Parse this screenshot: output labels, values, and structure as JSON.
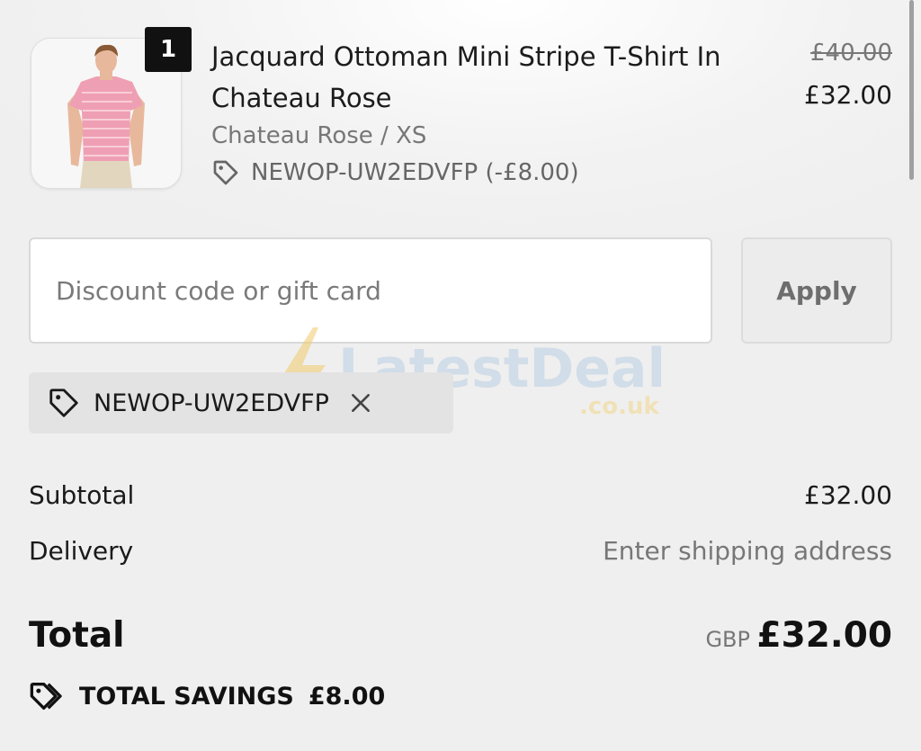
{
  "product": {
    "quantity": "1",
    "title": "Jacquard Ottoman Mini Stripe T-Shirt In Chateau Rose",
    "variant": "Chateau Rose / XS",
    "applied_code": "NEWOP-UW2EDVFP (-£8.00)",
    "original_price": "£40.00",
    "price": "£32.00",
    "image_icon": "product-photo"
  },
  "discount": {
    "placeholder": "Discount code or gift card",
    "value": "",
    "apply_label": "Apply",
    "chip_code": "NEWOP-UW2EDVFP"
  },
  "watermark": {
    "brand": "LatestDeals",
    "domain": ".co.uk"
  },
  "summary": {
    "subtotal_label": "Subtotal",
    "subtotal_value": "£32.00",
    "delivery_label": "Delivery",
    "delivery_value": "Enter shipping address",
    "total_label": "Total",
    "currency": "GBP",
    "total_value": "£32.00",
    "savings_label": "TOTAL SAVINGS",
    "savings_value": "£8.00"
  },
  "colors": {
    "background": "#efefef",
    "text": "#1a1a1a",
    "muted": "#777777",
    "shirt_pink": "#ef9fb3"
  }
}
